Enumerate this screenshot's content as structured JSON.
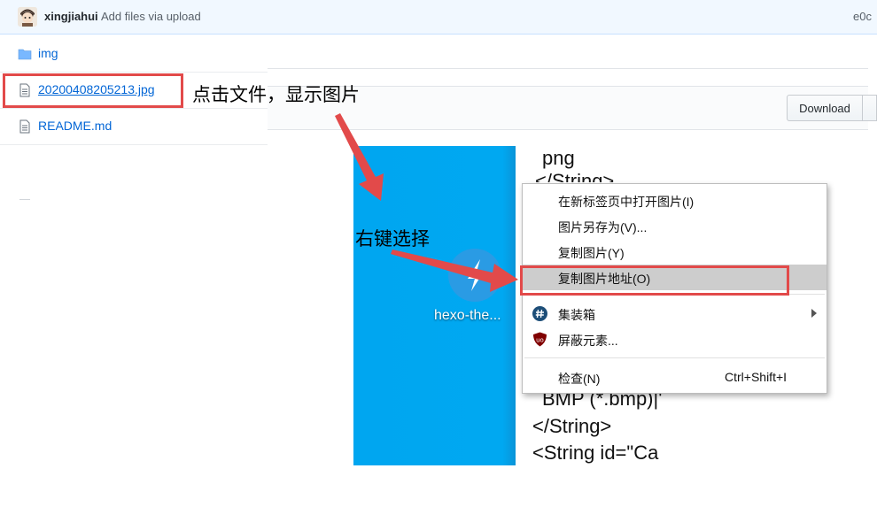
{
  "commit": {
    "author": "xingjiahui",
    "message": "Add files via upload",
    "sha": "e0c"
  },
  "files": [
    {
      "name": "img",
      "icon": "folder-icon"
    },
    {
      "name": "20200408205213.jpg",
      "icon": "file-icon"
    },
    {
      "name": "README.md",
      "icon": "file-icon"
    }
  ],
  "blob": {
    "download_label": "Download"
  },
  "annotations": {
    "click_file": "点击文件，显示图片",
    "right_click": "右键选择"
  },
  "preview": {
    "app_label": "hexo-the...",
    "code_lines": [
      "png",
      "</String>",
      "BMP (*.bmp)|'",
      "</String>",
      "<String id=\"Ca"
    ]
  },
  "context_menu": {
    "items": [
      {
        "label": "在新标签页中打开图片(I)"
      },
      {
        "label": "图片另存为(V)..."
      },
      {
        "label": "复制图片(Y)"
      },
      {
        "label": "复制图片地址(O)"
      },
      {
        "label": "集装箱"
      },
      {
        "label": "屏蔽元素..."
      },
      {
        "label": "检查(N)",
        "shortcut": "Ctrl+Shift+I"
      }
    ]
  },
  "colors": {
    "link": "#0366d6",
    "annotation_red": "#e24a4a",
    "preview_blue": "#00a6f0",
    "menu_highlight": "#cdcdcd"
  }
}
